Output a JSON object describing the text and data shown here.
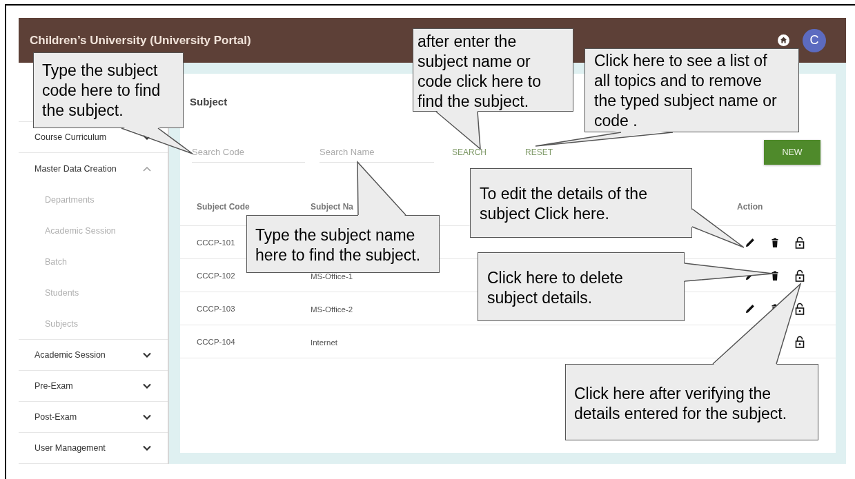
{
  "header": {
    "title": "Children’s University (University Portal)",
    "avatar_letter": "C"
  },
  "sidebar": {
    "items": [
      {
        "label": "Course Curriculum",
        "expanded": false
      },
      {
        "label": "Master Data Creation",
        "expanded": true,
        "children": [
          {
            "label": "Departments"
          },
          {
            "label": "Academic Session"
          },
          {
            "label": "Batch"
          },
          {
            "label": "Students"
          },
          {
            "label": "Subjects"
          }
        ]
      },
      {
        "label": "Academic Session",
        "expanded": false
      },
      {
        "label": "Pre-Exam",
        "expanded": false
      },
      {
        "label": "Post-Exam",
        "expanded": false
      },
      {
        "label": "User Management",
        "expanded": false
      }
    ]
  },
  "content": {
    "heading": "Subject",
    "search_code": {
      "placeholder": "Search Code"
    },
    "search_name": {
      "placeholder": "Search Name"
    },
    "buttons": [
      {
        "label": "SEARCH",
        "kind": "text"
      },
      {
        "label": "RESET",
        "kind": "text"
      },
      {
        "label": "NEW",
        "kind": "primary"
      }
    ],
    "table": {
      "columns": [
        "Subject Code",
        "Subject Na",
        "Action"
      ],
      "rows": [
        {
          "code": "CCCP-101",
          "actions": [
            {
              "kind": "edit"
            },
            {
              "kind": "delete"
            },
            {
              "kind": "lock"
            }
          ]
        },
        {
          "code": "CCCP-102",
          "name": "MS-Office-1",
          "actions": [
            {
              "kind": "edit"
            },
            {
              "kind": "delete"
            },
            {
              "kind": "lock"
            }
          ]
        },
        {
          "code": "CCCP-103",
          "name": "MS-Office-2",
          "actions": [
            {
              "kind": "edit"
            },
            {
              "kind": "delete"
            },
            {
              "kind": "lock"
            }
          ]
        },
        {
          "code": "CCCP-104",
          "name": "Internet",
          "actions": [
            {
              "kind": "lock"
            }
          ]
        }
      ]
    }
  },
  "callouts": [
    {
      "text": "Type the subject code here to find the subject."
    },
    {
      "text": "after enter the subject name or code click here to find the subject."
    },
    {
      "text": "Click here to see a list of all topics and to remove the typed subject name or code ."
    },
    {
      "text": "Type the subject name here to find the subject."
    },
    {
      "text": "To edit the details of the subject Click here."
    },
    {
      "text": "Click here to delete subject details."
    },
    {
      "text": "Click here after verifying the details entered for the subject."
    }
  ]
}
